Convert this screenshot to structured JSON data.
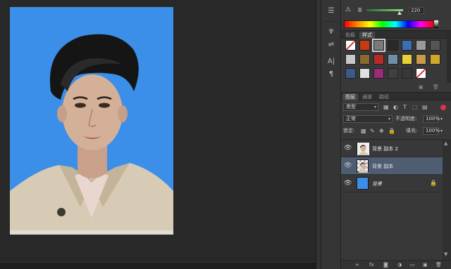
{
  "color_panel": {
    "b_letter": "B",
    "b_value": "220",
    "warn_icon": "warning-icon"
  },
  "styles_panel": {
    "tabs": [
      "色板",
      "样式"
    ],
    "active_tab": "样式",
    "swatches": [
      {
        "c": "#ffffff",
        "x": "none"
      },
      {
        "c": "#c83a14"
      },
      {
        "c": "#7a7a7a",
        "sel": true
      },
      {
        "c": "#2a2a2a"
      },
      {
        "c": "#3a6fb6"
      },
      {
        "c": "#9a9a9a"
      },
      {
        "c": "#555555"
      },
      {
        "c": "#c8c8c8"
      },
      {
        "c": "#8a6a2a"
      },
      {
        "c": "#b82a2a"
      },
      {
        "c": "#6e8fa8"
      },
      {
        "c": "#e8d03a"
      },
      {
        "c": "#c89a4a"
      },
      {
        "c": "#cfa82a"
      },
      {
        "c": "#3a5a8a"
      },
      {
        "c": "#e0e0e0"
      },
      {
        "c": "#9a2a7a"
      },
      {
        "c": "#404040"
      },
      {
        "c": "#383838"
      },
      {
        "c": "#ffffff",
        "x": "none"
      }
    ]
  },
  "layers_panel": {
    "tabs": [
      "图层",
      "通道",
      "路径"
    ],
    "active_tab": "图层",
    "filter_kind": "类型",
    "blend_mode": "正常",
    "opacity_label": "不透明度:",
    "opacity_value": "100%",
    "lock_label": "锁定:",
    "fill_label": "填充:",
    "fill_value": "100%",
    "layers": [
      {
        "name": "背景 副本 2",
        "thumb": "photo",
        "selected": false,
        "locked": false
      },
      {
        "name": "背景 副本",
        "thumb": "transparent",
        "selected": true,
        "locked": false
      },
      {
        "name": "背景",
        "thumb": "#3c8fe8",
        "selected": false,
        "locked": true
      }
    ]
  }
}
